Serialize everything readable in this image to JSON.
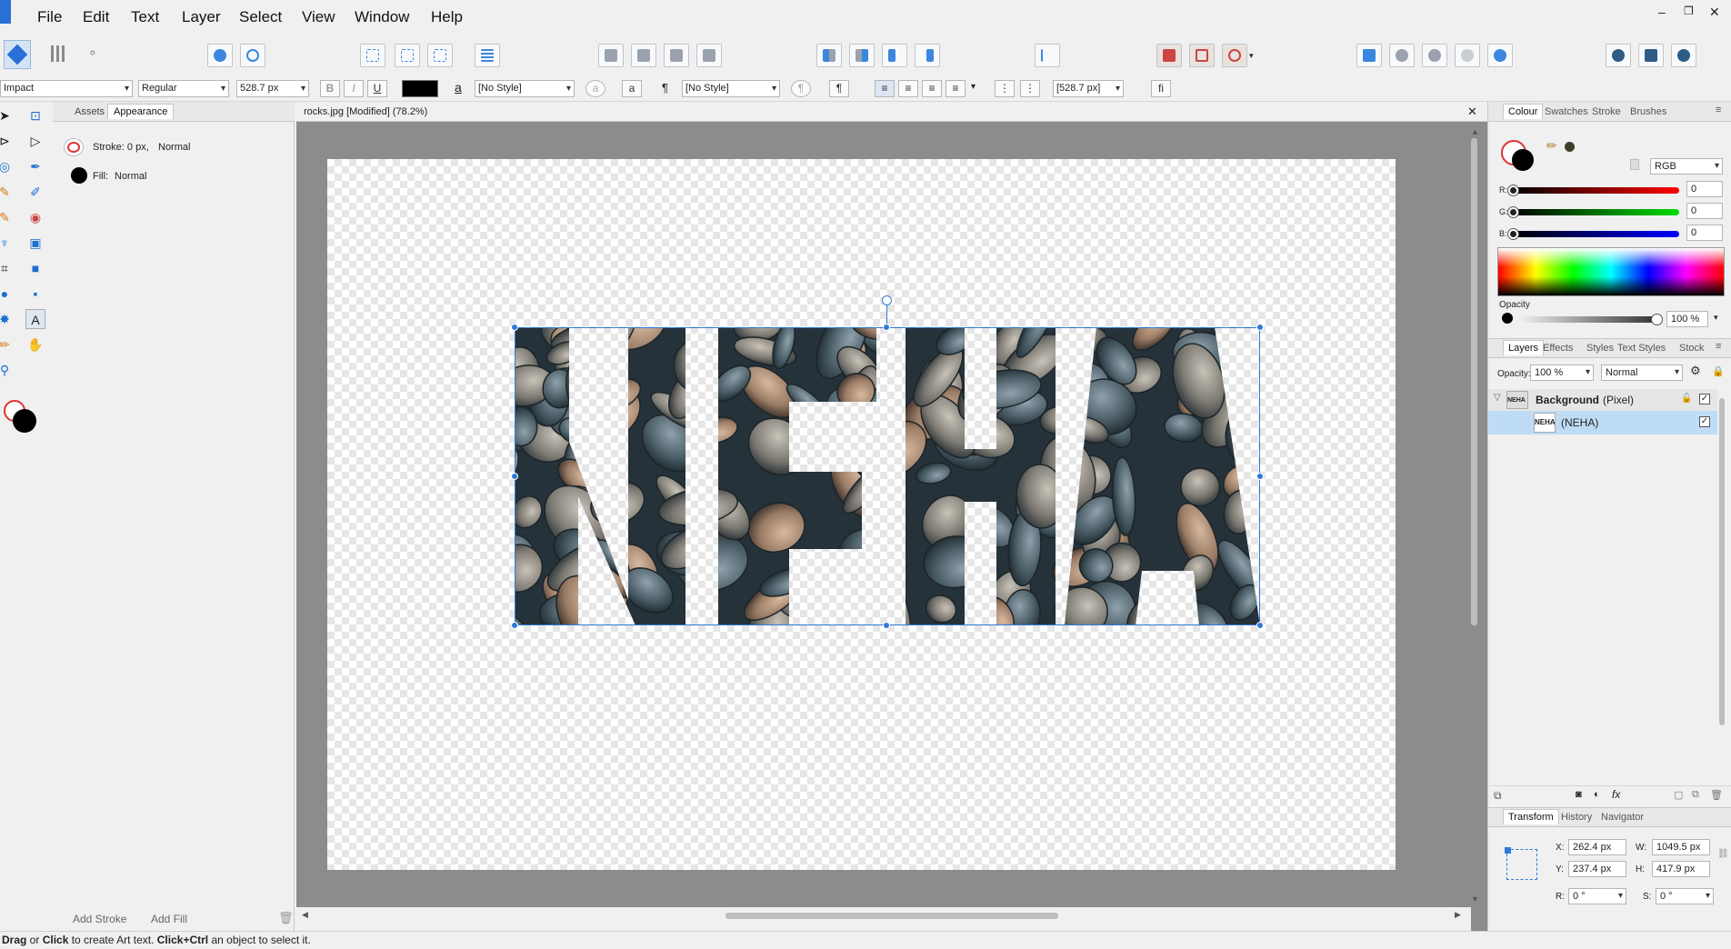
{
  "menu": [
    "File",
    "Edit",
    "Text",
    "Layer",
    "Select",
    "View",
    "Window",
    "Help"
  ],
  "context": {
    "font": "Impact",
    "style": "Regular",
    "size": "528.7 px",
    "bold": "B",
    "italic": "I",
    "underline": "U",
    "char_style": "[No Style]",
    "para_style": "[No Style]",
    "leading": "[528.7 px]",
    "fi": "fi",
    "a_glyph": "a",
    "pilcrow": "¶"
  },
  "left_panel": {
    "tabs": [
      "Assets",
      "Appearance"
    ],
    "stroke_label": "Stroke: 0 px,",
    "stroke_mode": "Normal",
    "fill_label": "Fill:",
    "fill_mode": "Normal",
    "add_stroke": "Add Stroke",
    "add_fill": "Add Fill"
  },
  "document": {
    "title": "rocks.jpg [Modified] (78.2%)",
    "art_text": "NEHA"
  },
  "colour_panel": {
    "tabs": [
      "Colour",
      "Swatches",
      "Stroke",
      "Brushes"
    ],
    "model": "RGB",
    "r_label": "R:",
    "r": "0",
    "g_label": "G:",
    "g": "0",
    "b_label": "B:",
    "b": "0",
    "opacity_label": "Opacity",
    "opacity": "100 %"
  },
  "layers_panel": {
    "tabs": [
      "Layers",
      "Effects",
      "Styles",
      "Text Styles",
      "Stock"
    ],
    "opacity_label": "Opacity:",
    "opacity": "100 %",
    "blend": "Normal",
    "layers": [
      {
        "name": "Background",
        "kind": "(Pixel)"
      },
      {
        "name": "(NEHA)",
        "kind": ""
      }
    ],
    "thumb_text": "NEHA"
  },
  "transform_panel": {
    "tabs": [
      "Transform",
      "History",
      "Navigator"
    ],
    "x_label": "X:",
    "x": "262.4 px",
    "y_label": "Y:",
    "y": "237.4 px",
    "w_label": "W:",
    "w": "1049.5 px",
    "h_label": "H:",
    "h": "417.9 px",
    "r_label": "R:",
    "r": "0 °",
    "s_label": "S:",
    "s": "0 °"
  },
  "status": {
    "drag": "Drag",
    "or": " or ",
    "click": "Click",
    "mid": " to create Art text. ",
    "clickctrl": "Click+Ctrl",
    "end": " an object to select it."
  },
  "colors": {
    "accent": "#2f7ad9",
    "selected_layer": "#bfdcf5"
  }
}
